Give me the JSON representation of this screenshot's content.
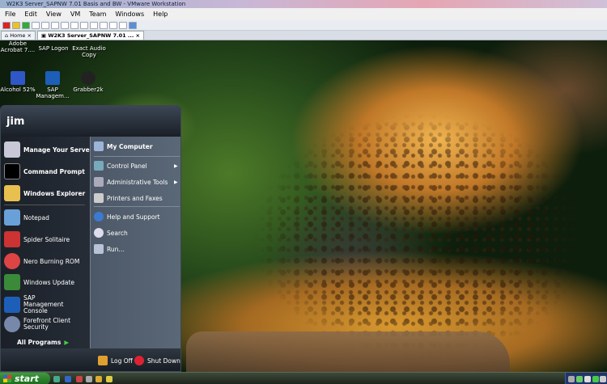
{
  "window": {
    "title": "W2K3 Server_SAPNW 7.01 Basis and  BW - VMware Workstation"
  },
  "menu": [
    "File",
    "Edit",
    "View",
    "VM",
    "Team",
    "Windows",
    "Help"
  ],
  "tabs": [
    {
      "label": "Home"
    },
    {
      "label": "W2K3 Server_SAPNW 7.01 ..."
    }
  ],
  "desktop_icons": [
    {
      "label": "Adobe Acrobat 7...."
    },
    {
      "label": "SAP Logon"
    },
    {
      "label": "Exact Audio Copy"
    },
    {
      "label": "Alcohol 52%"
    },
    {
      "label": "SAP Managem..."
    },
    {
      "label": "Grabber2k"
    }
  ],
  "start_menu": {
    "user": "jim",
    "pinned": [
      {
        "label": "Manage Your Server"
      },
      {
        "label": "Command Prompt"
      },
      {
        "label": "Windows Explorer"
      }
    ],
    "recent": [
      {
        "label": "Notepad"
      },
      {
        "label": "Spider Solitaire"
      },
      {
        "label": "Nero Burning ROM"
      },
      {
        "label": "Windows Update"
      },
      {
        "label": "SAP Management Console"
      },
      {
        "label": "Forefront Client Security"
      }
    ],
    "all_programs": "All Programs",
    "right": [
      {
        "label": "My Computer"
      },
      {
        "label": "Control Panel"
      },
      {
        "label": "Administrative Tools"
      },
      {
        "label": "Printers and Faxes"
      },
      {
        "label": "Help and Support"
      },
      {
        "label": "Search"
      },
      {
        "label": "Run..."
      }
    ],
    "logoff": "Log Off",
    "shutdown": "Shut Down"
  },
  "taskbar": {
    "start": "start"
  },
  "colors": {
    "start_green": "#2e8b2e",
    "menu_dark": "#20262e",
    "menu_right": "#566270",
    "tray_blue": "#22346a"
  }
}
